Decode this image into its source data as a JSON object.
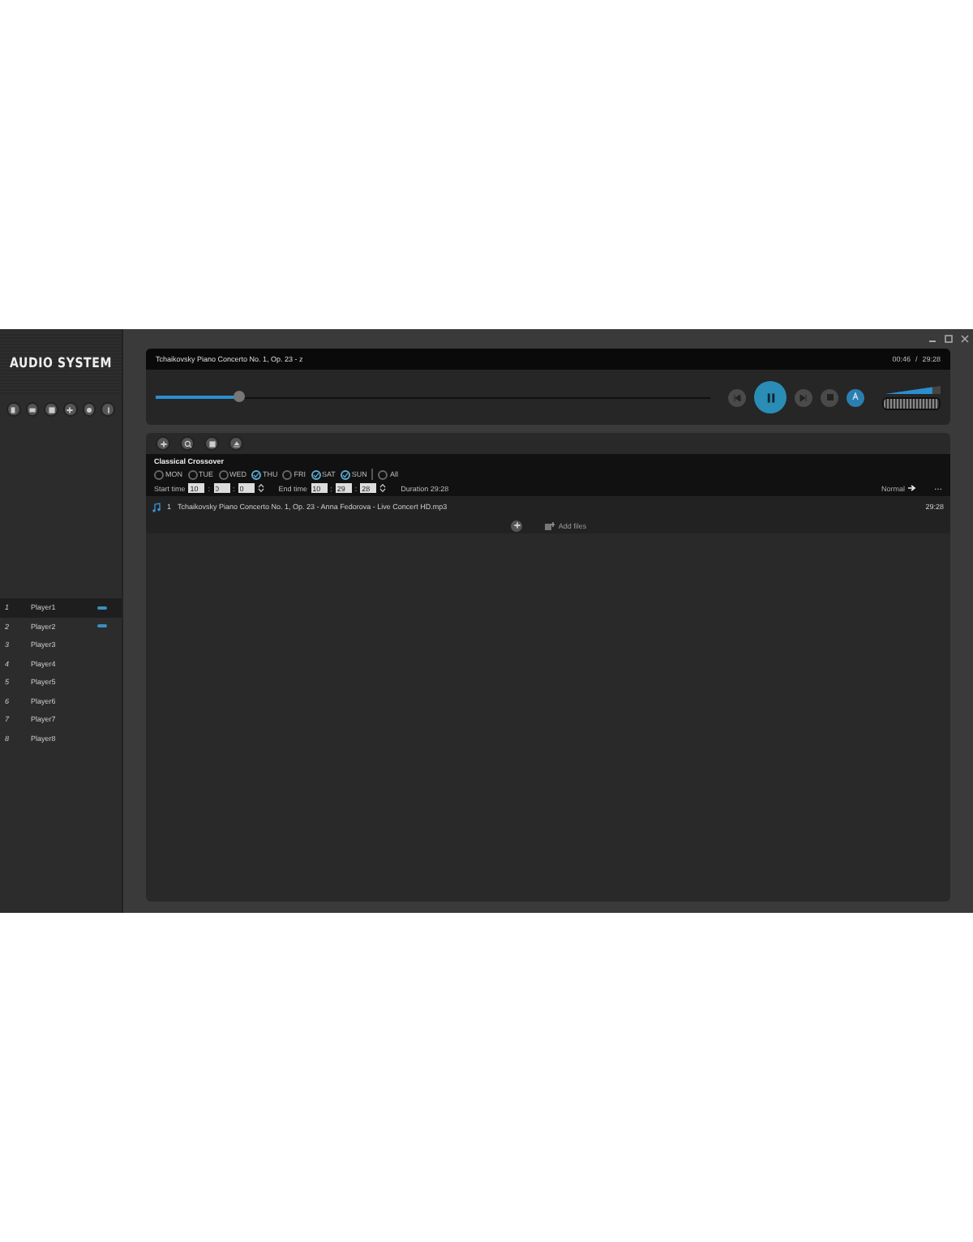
{
  "sidebar": {
    "logo": "AUDIO SYSTEM",
    "players": [
      {
        "number": "1",
        "name": "Player1",
        "selected": true,
        "playing": true
      },
      {
        "number": "2",
        "name": "Player2",
        "selected": false,
        "playing": true
      },
      {
        "number": "3",
        "name": "Player3",
        "selected": false,
        "playing": false
      },
      {
        "number": "4",
        "name": "Player4",
        "selected": false,
        "playing": false
      },
      {
        "number": "5",
        "name": "Player5",
        "selected": false,
        "playing": false
      },
      {
        "number": "6",
        "name": "Player6",
        "selected": false,
        "playing": false
      },
      {
        "number": "7",
        "name": "Player7",
        "selected": false,
        "playing": false
      },
      {
        "number": "8",
        "name": "Player8",
        "selected": false,
        "playing": false
      }
    ]
  },
  "now_playing": {
    "title": "Tchaikovsky Piano Concerto No. 1, Op. 23 - z",
    "elapsed": "00:46",
    "separator": "/",
    "total": "29:28",
    "level": 0.15,
    "playing": true,
    "volume": {
      "level": 0.85
    }
  },
  "playlist": {
    "name": "Classical Crossover",
    "days": [
      {
        "label": "MON",
        "checked": false
      },
      {
        "label": "TUE",
        "checked": false
      },
      {
        "label": "WED",
        "checked": false
      },
      {
        "label": "THU",
        "checked": true
      },
      {
        "label": "FRI",
        "checked": false
      },
      {
        "label": "SAT",
        "checked": true
      },
      {
        "label": "SUN",
        "checked": true
      },
      {
        "label": "All",
        "checked": false
      }
    ],
    "time_separator": ":",
    "start_label": "Start time",
    "start": [
      "10",
      "0",
      "0"
    ],
    "end_label": "End time",
    "end": [
      "10",
      "29",
      "28"
    ],
    "duration": "Duration 29:28",
    "mode": "Normal",
    "more": "...",
    "tracks": [
      {
        "number": "1",
        "title": "Tchaikovsky Piano Concerto No. 1, Op. 23 - Anna Fedorova - Live Concert HD.mp3",
        "duration": "29:28"
      }
    ],
    "add_files": "Add files"
  }
}
